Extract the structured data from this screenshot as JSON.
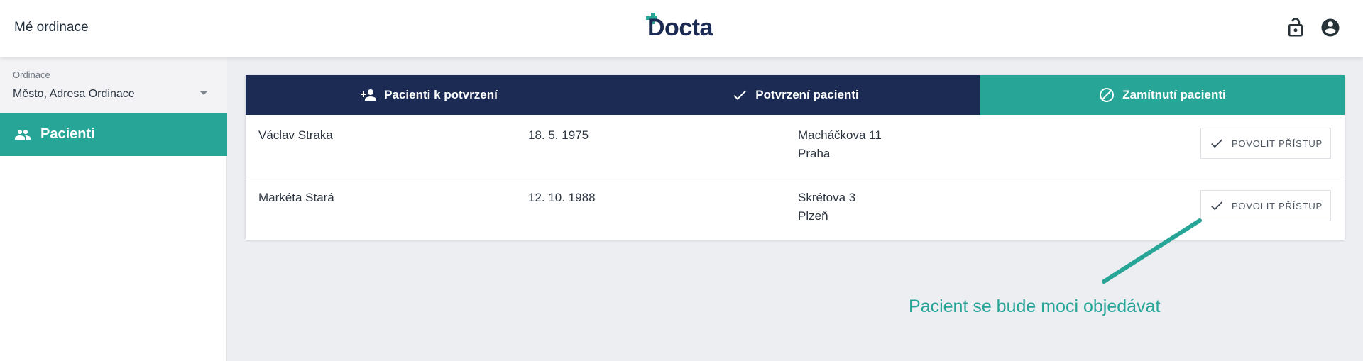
{
  "colors": {
    "navy": "#1b2b54",
    "teal": "#27a698",
    "background": "#edeef2"
  },
  "header": {
    "title": "Mé ordinace",
    "logo_text": "Docta",
    "icons": [
      "lock-open-icon",
      "account-circle-icon"
    ]
  },
  "sidebar": {
    "clinic_select": {
      "label": "Ordinace",
      "value": "Město, Adresa Ordinace"
    },
    "items": [
      {
        "label": "Pacienti",
        "icon": "people-icon",
        "active": true
      }
    ]
  },
  "tabs": [
    {
      "label": "Pacienti k potvrzení",
      "icon": "person-add-icon",
      "active": false
    },
    {
      "label": "Potvrzení pacienti",
      "icon": "check-icon",
      "active": false
    },
    {
      "label": "Zamítnutí pacienti",
      "icon": "block-icon",
      "active": true
    }
  ],
  "patients": [
    {
      "name": "Václav Straka",
      "birth_date": "18. 5. 1975",
      "street": "Macháčkova 11",
      "city": "Praha",
      "action_label": "POVOLIT PŘÍSTUP"
    },
    {
      "name": "Markéta Stará",
      "birth_date": "12. 10. 1988",
      "street": "Skrétova 3",
      "city": "Plzeň",
      "action_label": "POVOLIT PŘÍSTUP"
    }
  ],
  "annotation": {
    "text": "Pacient se bude moci objedávat"
  }
}
